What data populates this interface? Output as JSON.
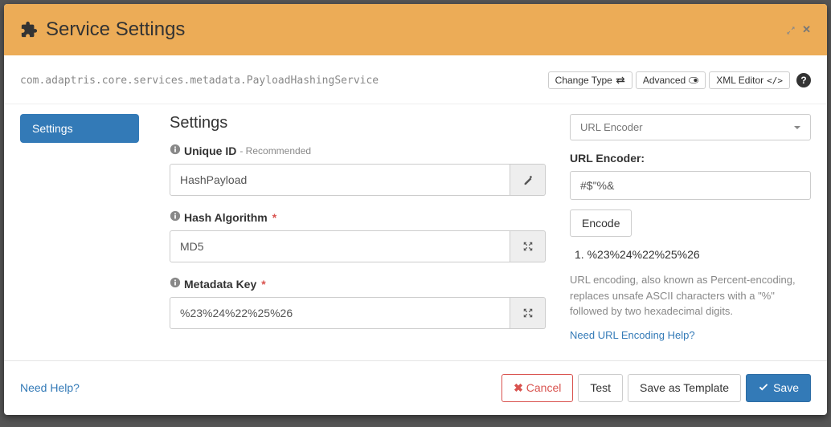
{
  "header": {
    "title": "Service Settings"
  },
  "subheader": {
    "classname": "com.adaptris.core.services.metadata.PayloadHashingService",
    "change_type": "Change Type",
    "advanced": "Advanced",
    "xml_editor": "XML Editor",
    "help_symbol": "?"
  },
  "sidebar": {
    "settings": "Settings"
  },
  "main": {
    "heading": "Settings",
    "unique_id": {
      "label": "Unique ID",
      "hint": "- Recommended",
      "value": "HashPayload"
    },
    "hash_algorithm": {
      "label": "Hash Algorithm",
      "value": "MD5"
    },
    "metadata_key": {
      "label": "Metadata Key",
      "value": "%23%24%22%25%26"
    }
  },
  "encoder": {
    "dropdown_label": "URL Encoder",
    "section_label": "URL Encoder:",
    "input_value": "#$\"%&",
    "encode_button": "Encode",
    "results": [
      "%23%24%22%25%26"
    ],
    "description": "URL encoding, also known as Percent-encoding, replaces unsafe ASCII characters with a \"%\" followed by two hexadecimal digits.",
    "help_link": "Need URL Encoding Help?"
  },
  "footer": {
    "need_help": "Need Help?",
    "cancel": "Cancel",
    "test": "Test",
    "save_template": "Save as Template",
    "save": "Save"
  }
}
